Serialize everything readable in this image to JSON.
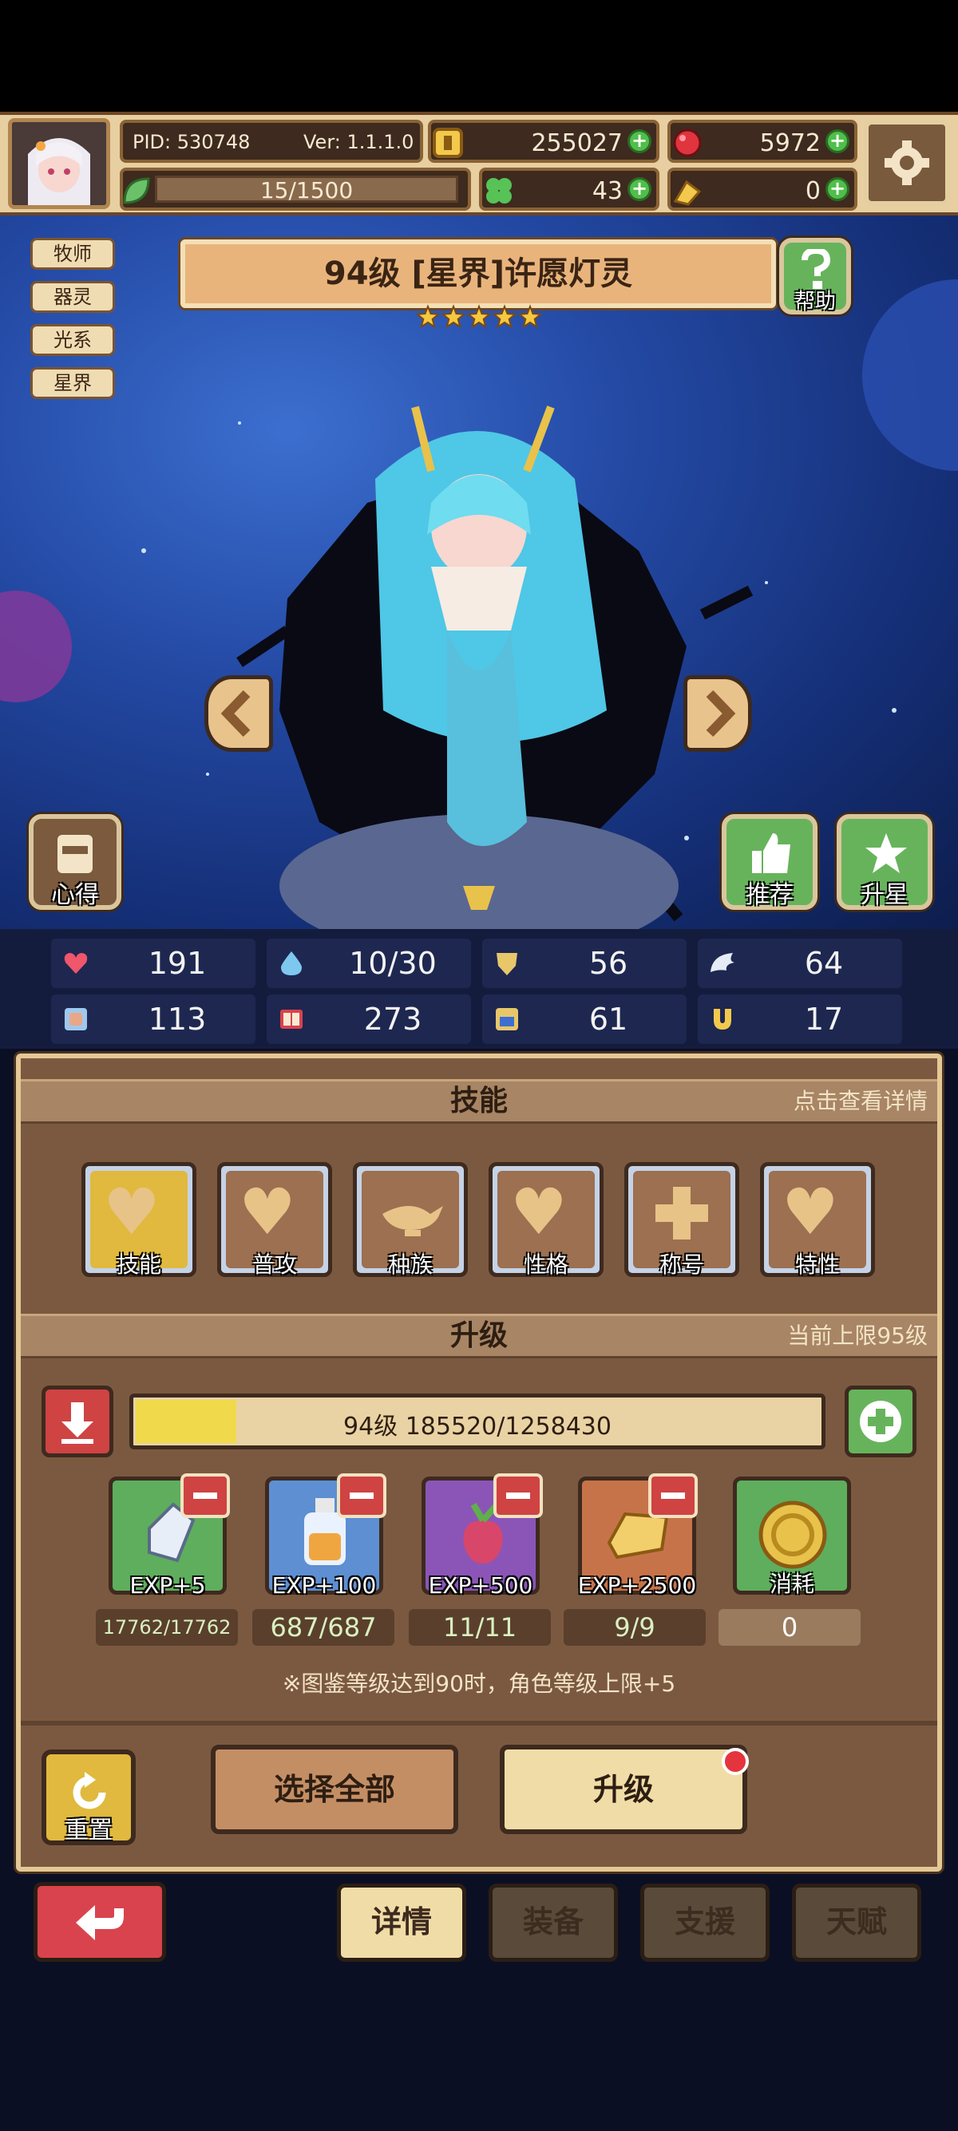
{
  "header": {
    "pid": "PID: 530748",
    "version": "Ver: 1.1.1.0",
    "gold": "255027",
    "gems": "5972",
    "stamina": "15/1500",
    "clover": "43",
    "tickets": "0"
  },
  "tags": [
    "牧师",
    "器灵",
    "光系",
    "星界"
  ],
  "character": {
    "title": "94级  [星界]许愿灯灵",
    "stars": 5
  },
  "buttons": {
    "help": "帮助",
    "notes": "心得",
    "recommend": "推荐",
    "star_up": "升星"
  },
  "stats": [
    "191",
    "10/30",
    "56",
    "64",
    "113",
    "273",
    "61",
    "17"
  ],
  "skills_section": {
    "title": "技能",
    "hint": "点击查看详情",
    "items": [
      "技能",
      "普攻",
      "种族",
      "性格",
      "称号",
      "特性"
    ]
  },
  "upgrade_section": {
    "title": "升级",
    "hint": "当前上限95级",
    "exp_text": "94级  185520/1258430",
    "exp_progress": 0.147,
    "items": [
      {
        "label": "EXP+5",
        "count": "17762/17762"
      },
      {
        "label": "EXP+100",
        "count": "687/687"
      },
      {
        "label": "EXP+500",
        "count": "11/11"
      },
      {
        "label": "EXP+2500",
        "count": "9/9"
      },
      {
        "label": "消耗",
        "count": "0"
      }
    ],
    "note": "※图鉴等级达到90时，角色等级上限+5"
  },
  "actions": {
    "reset": "重置",
    "select_all": "选择全部",
    "upgrade": "升级"
  },
  "tabs": [
    "详情",
    "装备",
    "支援",
    "天赋"
  ],
  "colors": {
    "panel": "#7b5940",
    "accent_green": "#67b35c",
    "accent_red": "#cf4343",
    "exp_fill": "#f0da4c"
  }
}
